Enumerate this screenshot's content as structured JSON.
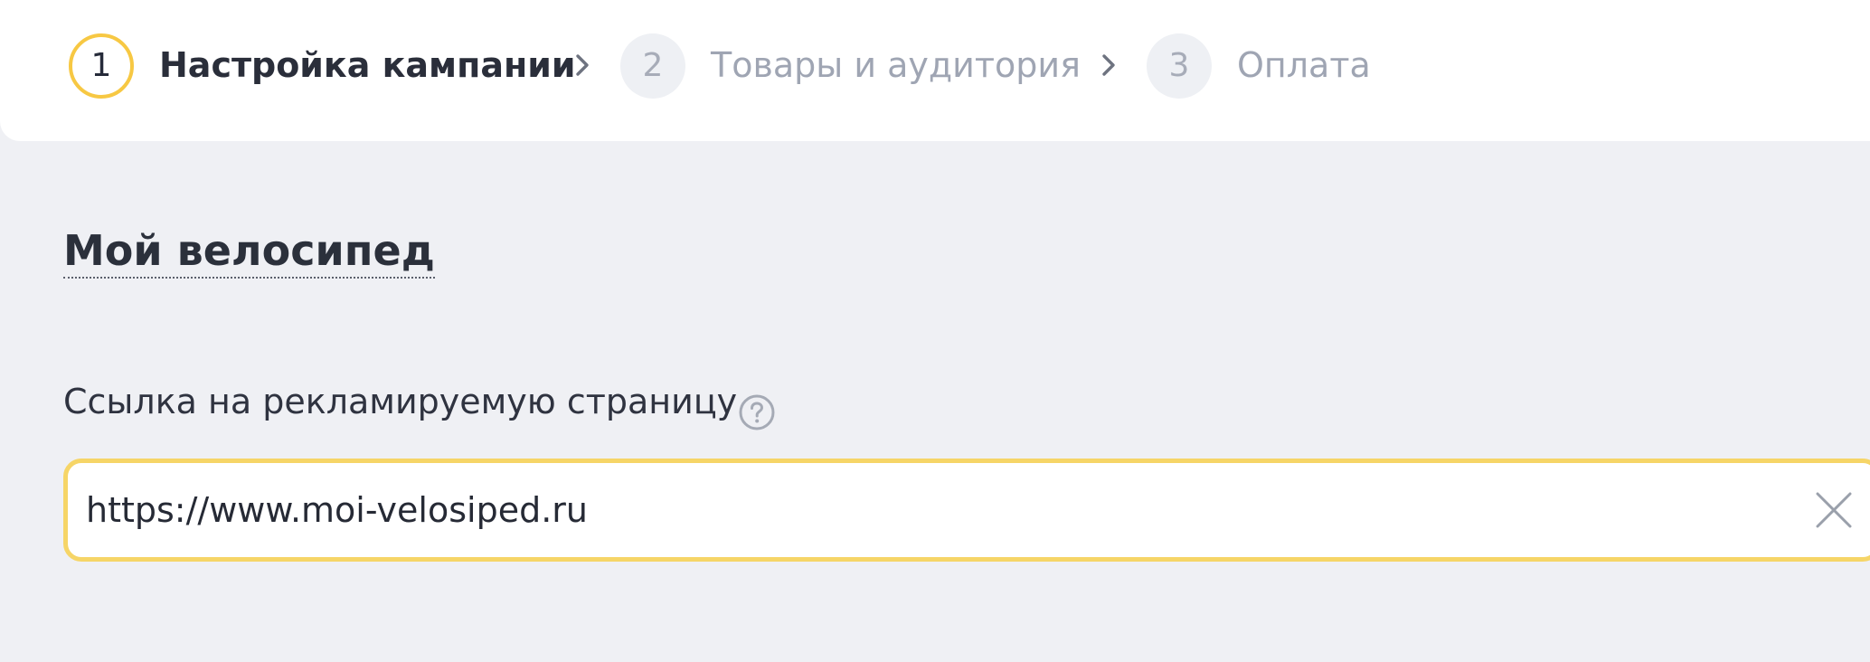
{
  "stepper": {
    "steps": [
      {
        "number": "1",
        "label": "Настройка кампании",
        "state": "active"
      },
      {
        "number": "2",
        "label": "Товары и аудитория",
        "state": "inactive"
      },
      {
        "number": "3",
        "label": "Оплата",
        "state": "inactive"
      }
    ]
  },
  "campaign": {
    "title": "Мой велосипед"
  },
  "url_field": {
    "label": "Ссылка на рекламируемую страницу",
    "value": "https://www.moi-velosiped.ru",
    "help_icon": "question-circle-icon",
    "clear_icon": "close-icon"
  },
  "colors": {
    "accent": "#f7c843",
    "page_background": "#eff0f4",
    "inactive_step": "#eef0f4"
  }
}
